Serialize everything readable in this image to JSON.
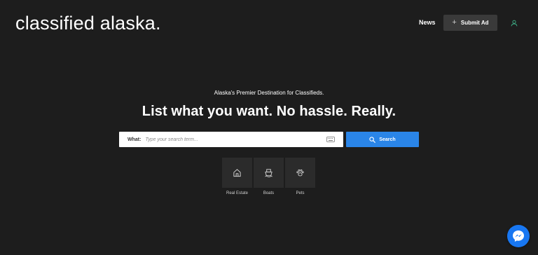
{
  "header": {
    "logo": "classified alaska.",
    "news_label": "News",
    "submit_label": "Submit Ad",
    "submit_plus": "+"
  },
  "hero": {
    "tagline": "Alaska's Premier Destination for Classifieds.",
    "headline": "List what you want. No hassle. Really."
  },
  "search": {
    "label": "What:",
    "placeholder": "Type your search term...",
    "button_label": "Search"
  },
  "categories": [
    {
      "label": "Real Estate",
      "icon": "house-icon"
    },
    {
      "label": "Boats",
      "icon": "boat-icon"
    },
    {
      "label": "Pets",
      "icon": "paw-icon"
    }
  ],
  "colors": {
    "background": "#1d1d1d",
    "accent": "#2a85e8",
    "tile": "#2b2b2b",
    "messenger": "#1877f2"
  }
}
